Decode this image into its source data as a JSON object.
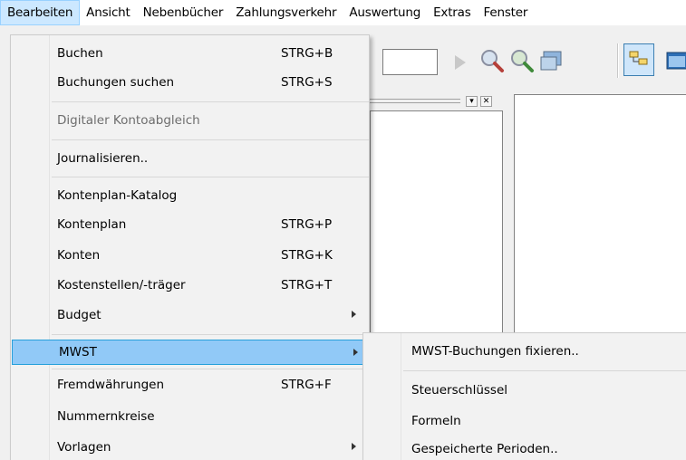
{
  "menubar": {
    "items": [
      {
        "label": "Bearbeiten"
      },
      {
        "label": "Ansicht"
      },
      {
        "label": "Nebenbücher"
      },
      {
        "label": "Zahlungsverkehr"
      },
      {
        "label": "Auswertung"
      },
      {
        "label": "Extras"
      },
      {
        "label": "Fenster"
      }
    ]
  },
  "menu": {
    "items": [
      {
        "label": "Buchen",
        "shortcut": "STRG+B"
      },
      {
        "label": "Buchungen suchen",
        "shortcut": "STRG+S"
      },
      {
        "label": "Digitaler Kontoabgleich"
      },
      {
        "label": "Journalisieren.."
      },
      {
        "label": "Kontenplan-Katalog"
      },
      {
        "label": "Kontenplan",
        "shortcut": "STRG+P"
      },
      {
        "label": "Konten",
        "shortcut": "STRG+K"
      },
      {
        "label": "Kostenstellen/-träger",
        "shortcut": "STRG+T"
      },
      {
        "label": "Budget"
      },
      {
        "label": "MWST"
      },
      {
        "label": "Fremdwährungen",
        "shortcut": "STRG+F"
      },
      {
        "label": "Nummernkreise"
      },
      {
        "label": "Vorlagen"
      }
    ]
  },
  "submenu": {
    "items": [
      {
        "label": "MWST-Buchungen fixieren.."
      },
      {
        "label": "Steuerschlüssel"
      },
      {
        "label": "Formeln"
      },
      {
        "label": "Gespeicherte Perioden.."
      }
    ]
  },
  "colors": {
    "menu_highlight": "#91c9f7",
    "menubar_active": "#cce8ff",
    "menu_background": "#f2f2f2",
    "disabled_text": "#6d6d6d"
  },
  "icons": [
    "play-icon",
    "zoom-in-icon",
    "zoom-out-icon",
    "window-icon",
    "tree-view-icon",
    "window-blue-icon",
    "dropdown-arrow-icon",
    "close-icon"
  ]
}
